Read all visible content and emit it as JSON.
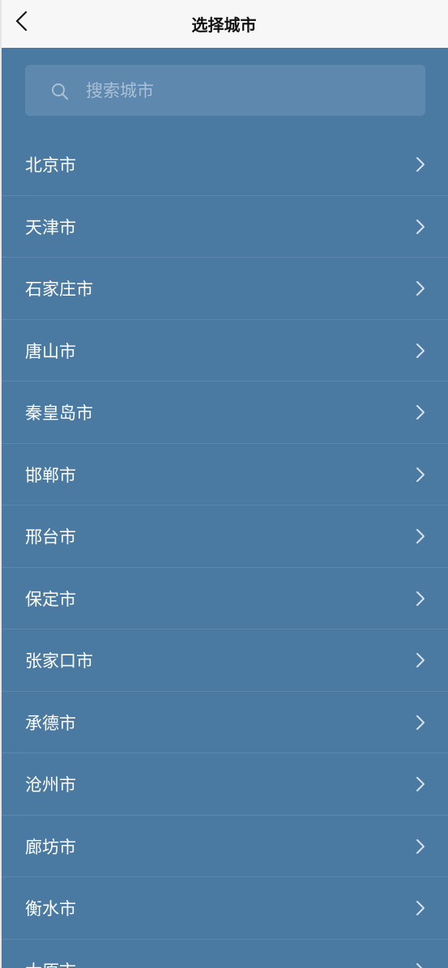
{
  "header": {
    "title": "选择城市"
  },
  "search": {
    "placeholder": "搜索城市",
    "value": ""
  },
  "cities": [
    {
      "name": "北京市"
    },
    {
      "name": "天津市"
    },
    {
      "name": "石家庄市"
    },
    {
      "name": "唐山市"
    },
    {
      "name": "秦皇岛市"
    },
    {
      "name": "邯郸市"
    },
    {
      "name": "邢台市"
    },
    {
      "name": "保定市"
    },
    {
      "name": "张家口市"
    },
    {
      "name": "承德市"
    },
    {
      "name": "沧州市"
    },
    {
      "name": "廊坊市"
    },
    {
      "name": "衡水市"
    },
    {
      "name": "太原市"
    }
  ],
  "icons": {
    "back": "chevron-left-icon",
    "search": "search-icon",
    "item_arrow": "chevron-right-icon"
  },
  "colors": {
    "header_bg": "#f7f7f7",
    "list_bg": "#4a79a1",
    "search_bg": "#5e88ad",
    "divider": "#5d87ab",
    "text": "#ffffff"
  }
}
